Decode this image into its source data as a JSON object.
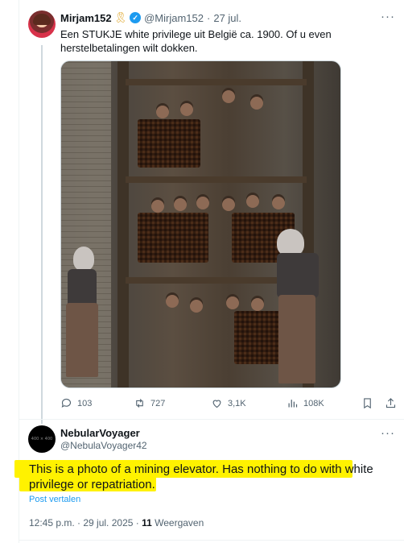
{
  "tweet": {
    "name": "Mirjam152",
    "ribbon_icon": "yellow-ribbon-icon",
    "verified_icon": "verified-badge-icon",
    "handle": "@Mirjam152",
    "separator": "·",
    "date": "27 jul.",
    "text": "Een STUKJE white privilege uit België ca. 1900. Of u even herstelbetalingen wilt dokken.",
    "actions": {
      "replies": "103",
      "reposts": "727",
      "likes": "3,1K",
      "views": "108K"
    }
  },
  "reply": {
    "name": "NebularVoyager",
    "avatar_text": "400 × 400",
    "handle": "@NebulaVoyager42",
    "text": "This is a photo of a mining elevator. Has nothing to do with white privilege or repatriation.",
    "translate_label": "Post vertalen",
    "time": "12:45 p.m. · 29 jul. 2025 · ",
    "views_count": "11",
    "views_label": " Weergaven",
    "highlight_color": "#fff200"
  },
  "more_icon": "···"
}
